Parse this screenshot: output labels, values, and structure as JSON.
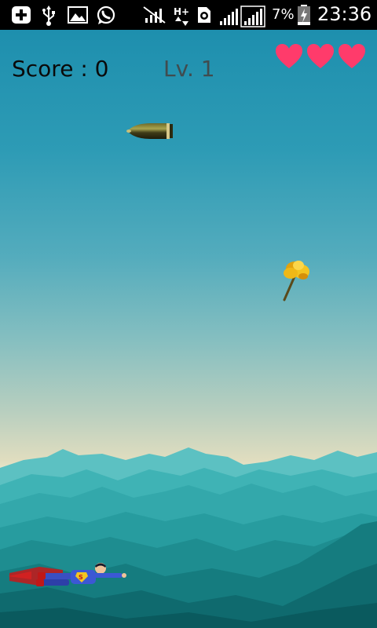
{
  "status_bar": {
    "battery": "7%",
    "time": "23:36",
    "icons": [
      "plus-box-icon",
      "usb-icon",
      "gallery-icon",
      "whatsapp-icon",
      "no-signal-icon",
      "data-transfer-icon",
      "sim-icon",
      "signal-icon",
      "signal-full-icon",
      "battery-charging-icon"
    ]
  },
  "hud": {
    "score_text": "Score : 0",
    "level_text": "Lv. 1",
    "lives": 3
  },
  "colors": {
    "heart": "#ff3b6b",
    "sky_top": "#1e8fae",
    "mountains": "#2aa5ad"
  },
  "sprites": [
    "bullet",
    "golden-flower",
    "superman-player"
  ]
}
